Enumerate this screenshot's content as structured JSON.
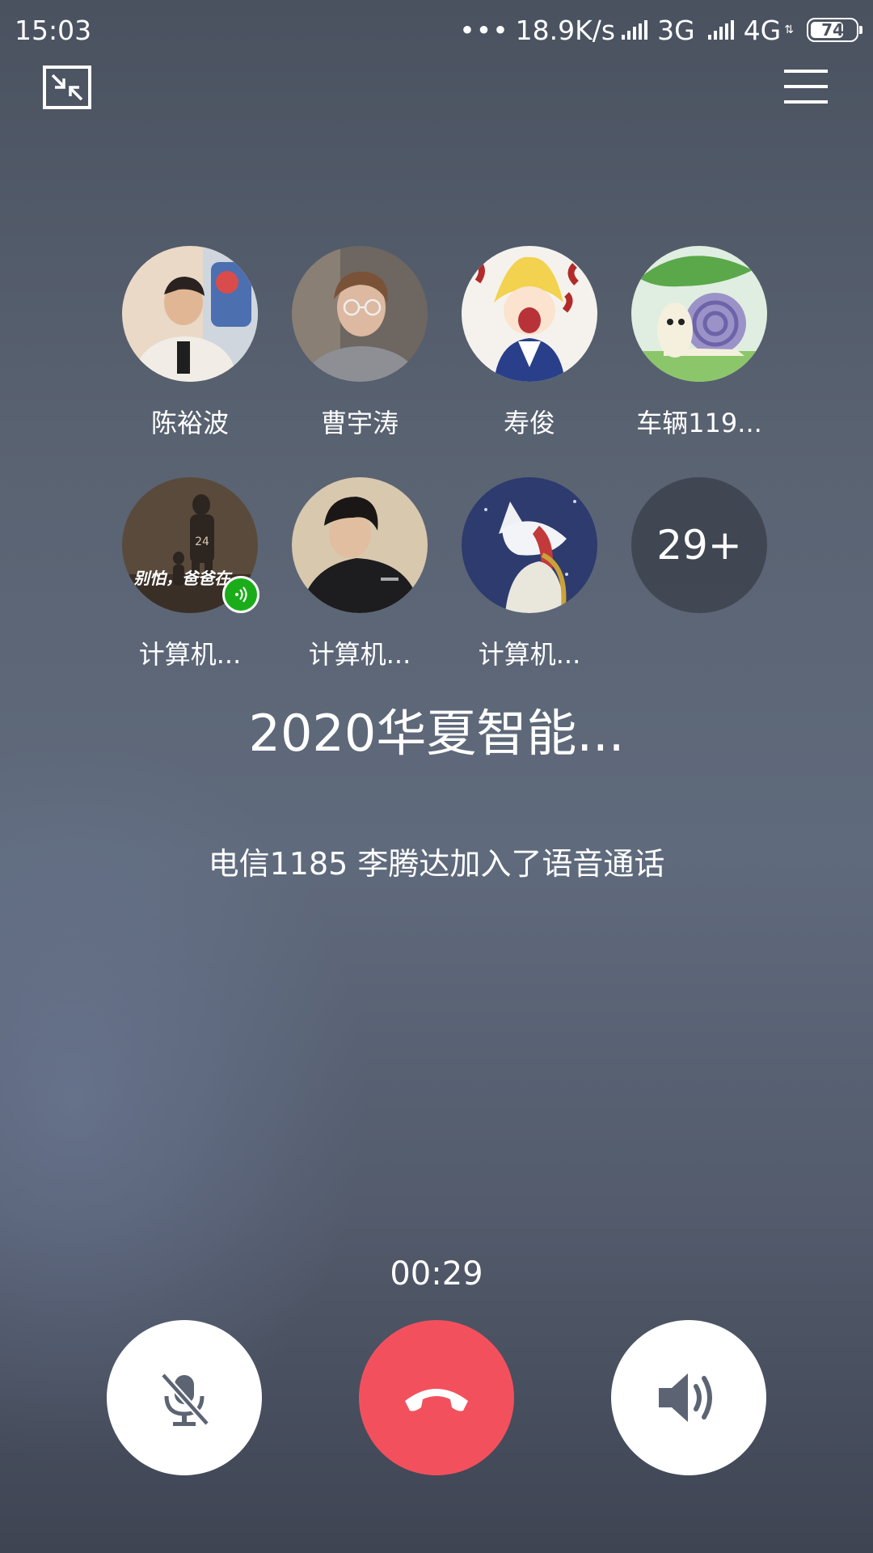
{
  "status_bar": {
    "time": "15:03",
    "net_dots": "•••",
    "net_speed": "18.9K/s",
    "network1": "3G",
    "network2": "4G",
    "battery": "74",
    "battery_level": 0.74
  },
  "top_controls": {
    "minimize_icon": "minimize-window-icon",
    "menu_icon": "menu-icon"
  },
  "participants": [
    {
      "name": "陈裕波",
      "icon": "avatar-person-hoodie"
    },
    {
      "name": "曹宇涛",
      "icon": "avatar-person-glasses"
    },
    {
      "name": "寿俊",
      "icon": "avatar-anime-girl"
    },
    {
      "name": "车辆119...",
      "icon": "avatar-snail"
    },
    {
      "name": "计算机...",
      "icon": "avatar-basketball",
      "speaking": true
    },
    {
      "name": "计算机...",
      "icon": "avatar-person-black-shirt"
    },
    {
      "name": "计算机...",
      "icon": "avatar-anime-fox"
    }
  ],
  "more_count": "29+",
  "group_title": "2020华夏智能...",
  "join_notice": "电信1185 李腾达加入了语音通话",
  "timer": "00:29",
  "avatar_text": "别怕，爸爸在",
  "jersey_number": "24",
  "controls": {
    "mute_icon": "microphone-muted-icon",
    "hangup_icon": "hang-up-phone-icon",
    "speaker_icon": "speaker-icon"
  },
  "colors": {
    "hangup": "#f3505e",
    "speaking_badge": "#1aad19"
  }
}
